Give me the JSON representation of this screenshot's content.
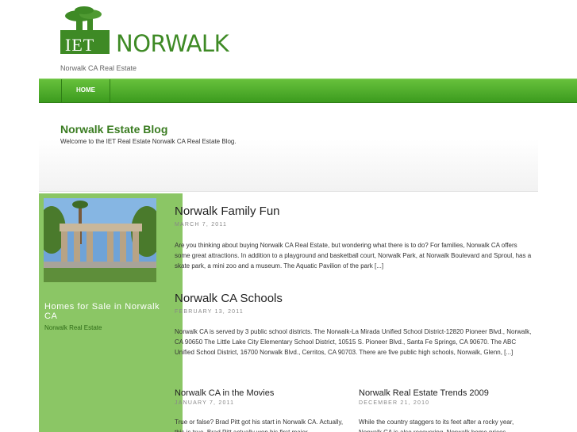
{
  "header": {
    "logo_iet": "IET",
    "logo_norwalk": "NORWALK",
    "tagline": "Norwalk CA Real Estate"
  },
  "nav": {
    "home_label": "HOME"
  },
  "banner": {
    "title": "Norwalk Estate Blog",
    "description": "Welcome to the IET Real Estate Norwalk CA Real Estate Blog."
  },
  "sidebar": {
    "heading": "Homes for Sale in Norwalk CA",
    "link": "Norwalk Real Estate"
  },
  "posts": [
    {
      "title": "Norwalk Family Fun",
      "date": "March 7, 2011",
      "excerpt": "Are you thinking about buying Norwalk CA Real Estate, but wondering what there is to do?  For families, Norwalk CA offers some great attractions.  In addition to a playground and basketball court, Norwalk Park, at Norwalk Boulevard and Sproul, has a skate park, a mini zoo and a museum.  The Aquatic Pavilion of the park [...]"
    },
    {
      "title": "Norwalk CA Schools",
      "date": "February 13, 2011",
      "excerpt": "Norwalk CA is served by 3 public school districts. The Norwalk-La Mirada Unified School District-12820 Pioneer Blvd., Norwalk, CA 90650 The Little Lake City Elementary School District, 10515 S. Pioneer Blvd., Santa Fe Springs, CA 90670. The ABC Unified School District, 16700 Norwalk Blvd., Cerritos, CA 90703. There are five public high schools, Norwalk, Glenn, [...]"
    },
    {
      "title": "Norwalk CA in the Movies",
      "date": "January 7, 2011",
      "excerpt": "True or false? Brad Pitt got his start in Norwalk CA.  Actually, this is true. Brad Pitt actually won his first major"
    },
    {
      "title": "Norwalk Real Estate Trends 2009",
      "date": "December 21, 2010",
      "excerpt": "While the country staggers to its feet after a rocky year, Norwalk CA is also recovering.  Norwalk home prices"
    }
  ]
}
